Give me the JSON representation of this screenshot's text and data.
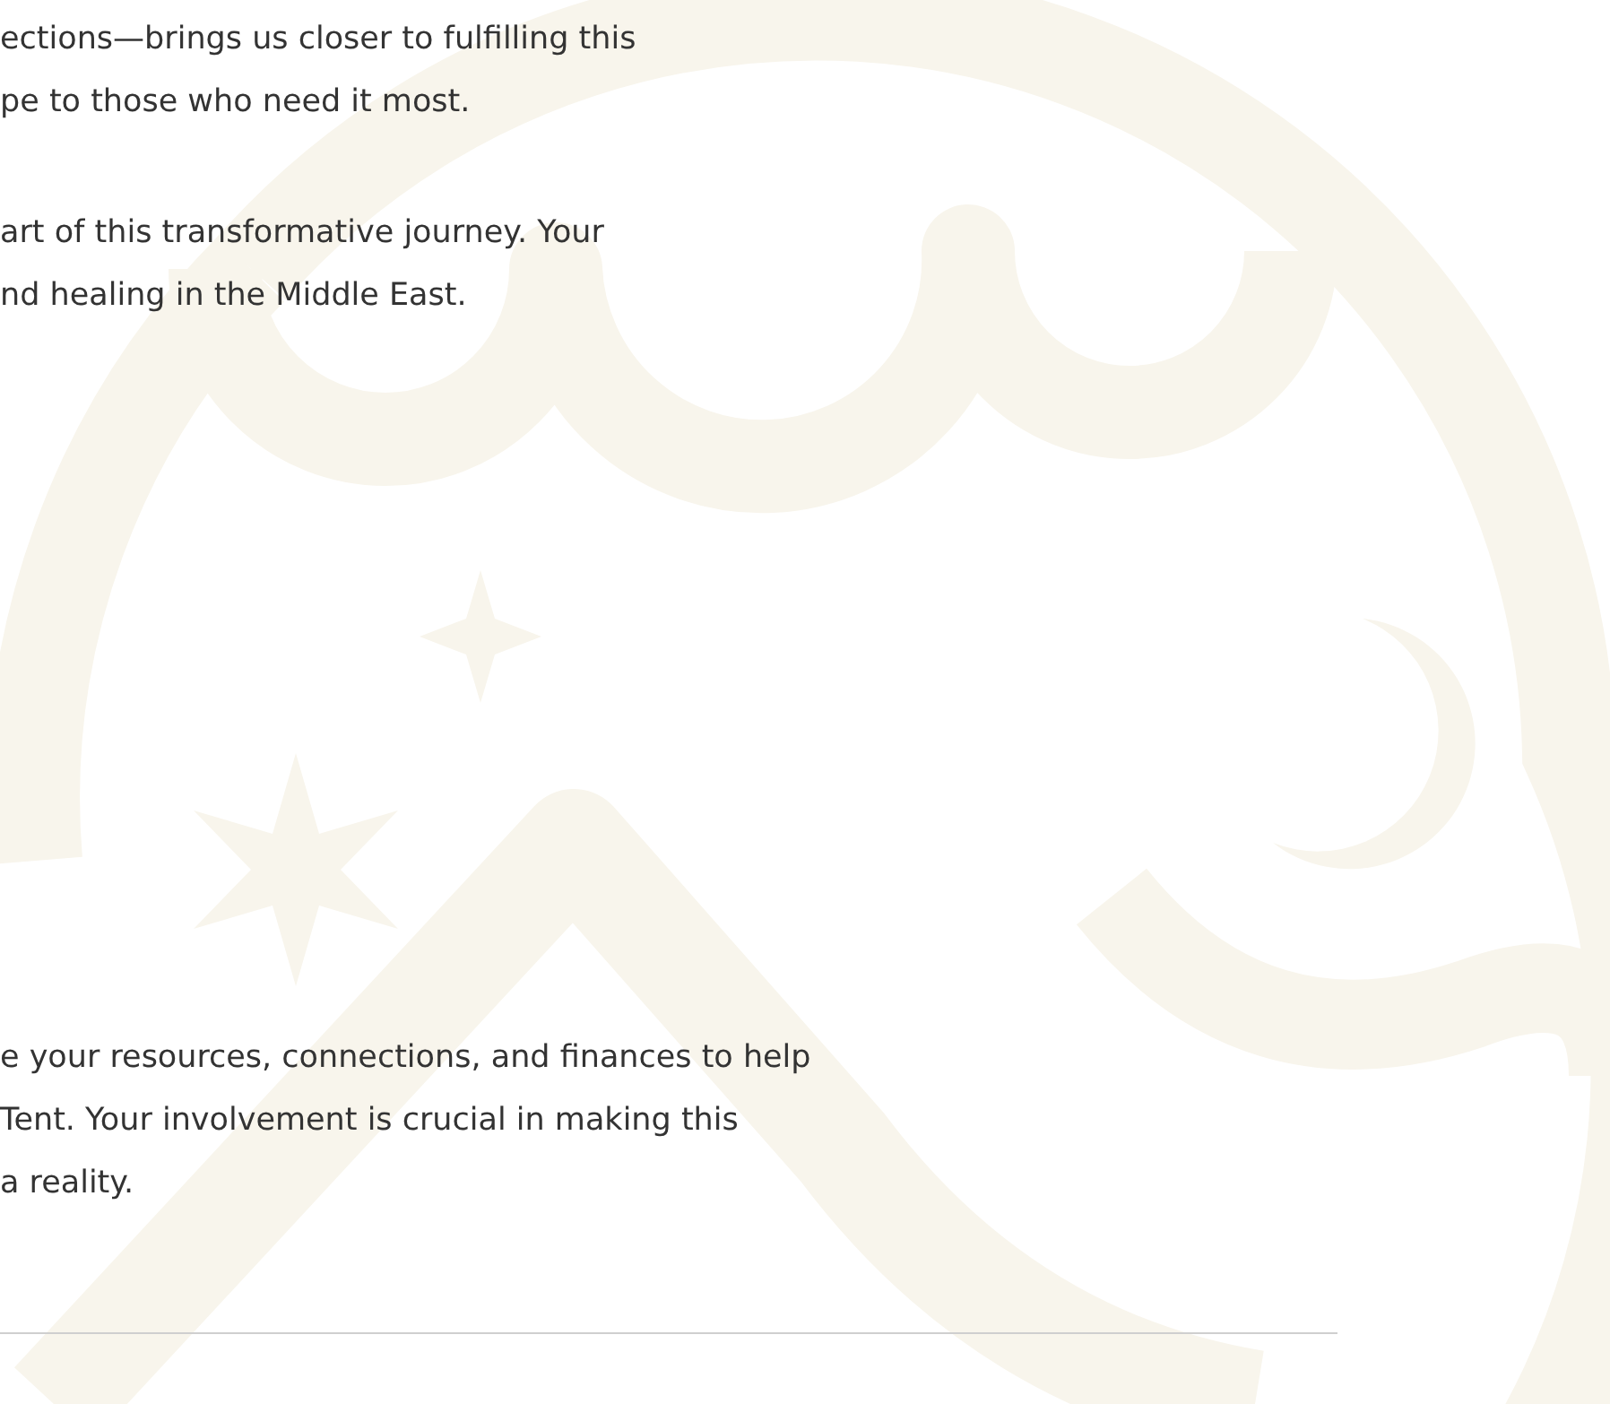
{
  "paragraphs": [
    {
      "lines": [
        "ections—brings us closer to fulfilling this",
        "pe to those who need it most."
      ]
    },
    {
      "lines": [
        "art of this transformative journey. Your",
        "nd healing in the Middle East."
      ]
    },
    {
      "lines": [
        "e your resources, connections, and finances to help",
        "Tent. Your involvement is crucial in making this",
        "a reality."
      ]
    }
  ]
}
